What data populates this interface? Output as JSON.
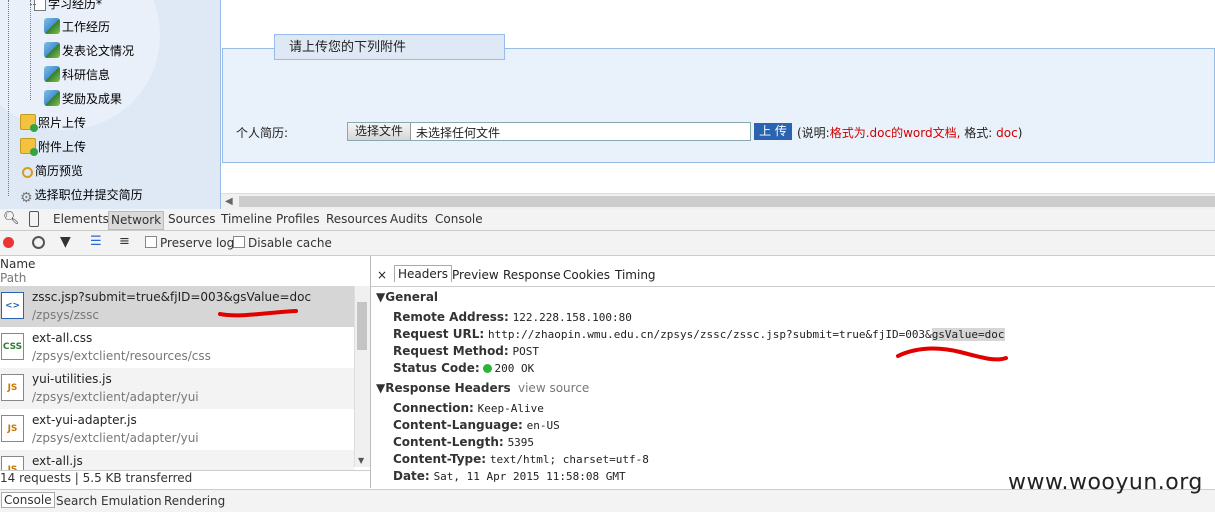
{
  "tree": {
    "items": [
      {
        "label": "学习经历*",
        "icon": "document-icon"
      },
      {
        "label": "工作经历",
        "icon": "leaf-icon"
      },
      {
        "label": "发表论文情况",
        "icon": "leaf-icon"
      },
      {
        "label": "科研信息",
        "icon": "leaf-icon"
      },
      {
        "label": "奖励及成果",
        "icon": "leaf-icon"
      },
      {
        "label": "照片上传",
        "icon": "folder-icon"
      },
      {
        "label": "附件上传",
        "icon": "folder-icon"
      },
      {
        "label": "简历预览",
        "icon": "magnifier-icon"
      },
      {
        "label": "选择职位并提交简历",
        "icon": "gear-icon"
      }
    ]
  },
  "form": {
    "legend": "请上传您的下列附件",
    "resume_label": "个人简历:",
    "choose_file": "选择文件",
    "no_file": "未选择任何文件",
    "upload": "上 传",
    "note_prefix": "(说明:",
    "note_red": "格式为.doc的word文档,",
    "note_mid": "格式:",
    "note_red2": "doc",
    "note_suffix": ")"
  },
  "devtools": {
    "tabs": [
      "Elements",
      "Network",
      "Sources",
      "Timeline",
      "Profiles",
      "Resources",
      "Audits",
      "Console"
    ],
    "active_tab": "Network",
    "preserve_log": "Preserve log",
    "disable_cache": "Disable cache",
    "col_name": "Name",
    "col_path": "Path",
    "requests": [
      {
        "name": "zssc.jsp?submit=true&fjID=003&gsValue=doc",
        "path": "/zpsys/zssc",
        "type": "html",
        "badge": "<>"
      },
      {
        "name": "ext-all.css",
        "path": "/zpsys/extclient/resources/css",
        "type": "css",
        "badge": "CSS"
      },
      {
        "name": "yui-utilities.js",
        "path": "/zpsys/extclient/adapter/yui",
        "type": "js",
        "badge": "JS"
      },
      {
        "name": "ext-yui-adapter.js",
        "path": "/zpsys/extclient/adapter/yui",
        "type": "js",
        "badge": "JS"
      },
      {
        "name": "ext-all.js",
        "path": "",
        "type": "js",
        "badge": "JS"
      }
    ],
    "status": "14 requests | 5.5 KB transferred",
    "detail_tabs": [
      "Headers",
      "Preview",
      "Response",
      "Cookies",
      "Timing"
    ],
    "close": "×",
    "general": {
      "title": "General",
      "remote_address_k": "Remote Address:",
      "remote_address_v": "122.228.158.100:80",
      "request_url_k": "Request URL:",
      "request_url_v": "http://zhaopin.wmu.edu.cn/zpsys/zssc/zssc.jsp?submit=true&fjID=003&",
      "request_url_hl": "gsValue=doc",
      "request_method_k": "Request Method:",
      "request_method_v": "POST",
      "status_code_k": "Status Code:",
      "status_code_v": "200 OK"
    },
    "response_headers": {
      "title": "Response Headers",
      "view_source": "view source",
      "rows": [
        {
          "k": "Connection:",
          "v": "Keep-Alive"
        },
        {
          "k": "Content-Language:",
          "v": "en-US"
        },
        {
          "k": "Content-Length:",
          "v": "5395"
        },
        {
          "k": "Content-Type:",
          "v": "text/html; charset=utf-8"
        },
        {
          "k": "Date:",
          "v": "Sat, 11 Apr 2015 11:58:08 GMT"
        }
      ]
    },
    "drawer_tabs": [
      "Console",
      "Search",
      "Emulation",
      "Rendering"
    ]
  },
  "watermark": "www.wooyun.org",
  "colors": {
    "annotation": "#e00000",
    "status_ok": "#2db436",
    "upload_button": "#2a64b0"
  }
}
